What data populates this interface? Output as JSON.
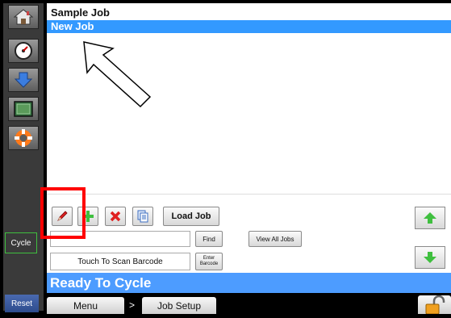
{
  "jobs": [
    {
      "label": "Sample Job",
      "selected": false
    },
    {
      "label": "New Job",
      "selected": true
    }
  ],
  "sidebar": {
    "items": [
      {
        "icon": "home-icon"
      },
      {
        "icon": "dial-gauge-icon"
      },
      {
        "icon": "download-arrow-icon"
      },
      {
        "icon": "screen-icon"
      },
      {
        "icon": "life-ring-icon"
      }
    ],
    "cycle_label": "Cycle",
    "reset_label": "Reset"
  },
  "toolbar": {
    "load_job_label": "Load Job",
    "find_label": "Find",
    "view_all_label": "View All Jobs",
    "search_value": "",
    "scan_label": "Touch To Scan Barcode",
    "enter_barcode_line1": "Enter",
    "enter_barcode_line2": "Barcode"
  },
  "status": {
    "text": "Ready To Cycle"
  },
  "breadcrumb": {
    "items": [
      "Menu",
      "Job Setup"
    ],
    "separator": ">"
  },
  "colors": {
    "selected_row": "#3399ff",
    "status_bar": "#4d9cff",
    "highlight_outline": "#ff0000",
    "up_arrow": "#3fbf3f",
    "down_arrow": "#3fbf3f"
  }
}
